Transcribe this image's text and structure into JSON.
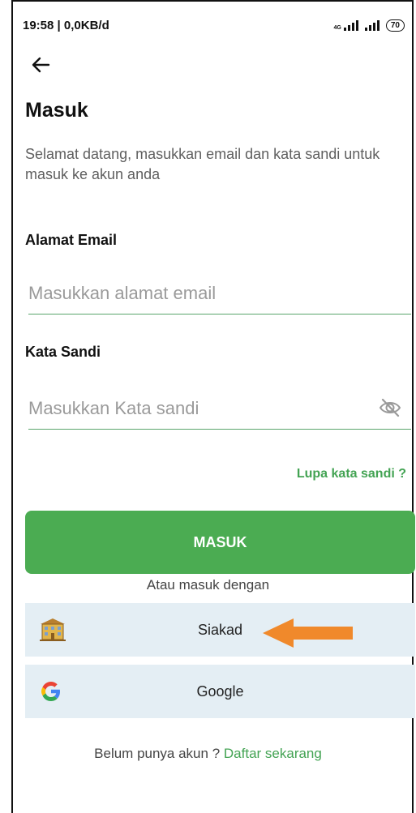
{
  "status_bar": {
    "time": "19:58 | 0,0KB/d",
    "network_label": "4G",
    "battery": "70"
  },
  "page": {
    "title": "Masuk",
    "subtitle": "Selamat datang, masukkan email dan kata sandi untuk masuk ke akun anda"
  },
  "form": {
    "email_label": "Alamat Email",
    "email_placeholder": "Masukkan alamat email",
    "password_label": "Kata Sandi",
    "password_placeholder": "Masukkan Kata sandi",
    "forgot_label": "Lupa kata sandi ?",
    "submit_label": "MASUK"
  },
  "social": {
    "divider_text": "Atau masuk dengan",
    "siakad_label": "Siakad",
    "google_label": "Google"
  },
  "footer": {
    "prompt": "Belum punya akun ?",
    "register_link": "Daftar sekarang"
  },
  "colors": {
    "accent": "#4bac52",
    "link": "#43a353",
    "social_bg": "#e4eef4",
    "annotation_arrow": "#f0892b"
  }
}
